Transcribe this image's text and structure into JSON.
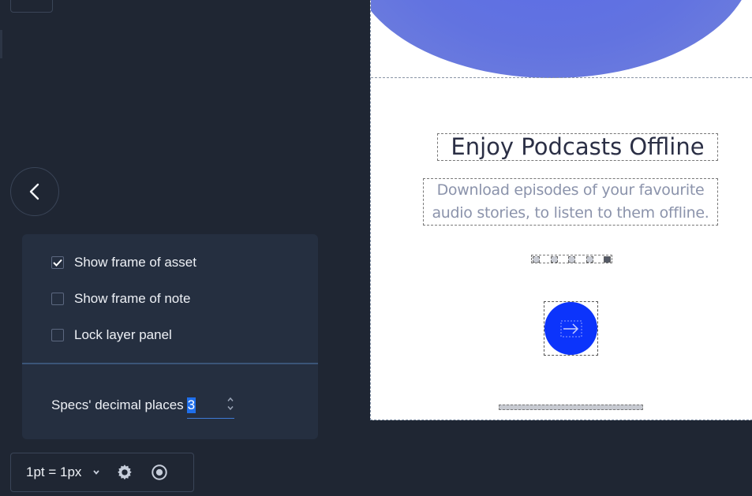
{
  "settings": {
    "show_frame_asset": {
      "label": "Show frame of asset",
      "checked": true
    },
    "show_frame_note": {
      "label": "Show frame of note",
      "checked": false
    },
    "lock_layer_panel": {
      "label": "Lock layer panel",
      "checked": false
    },
    "decimal_label": "Specs' decimal places",
    "decimal_value": "3"
  },
  "toolbar": {
    "unit_label": "1pt = 1px"
  },
  "icons": {
    "back": "chevron-left-icon",
    "unit_dropdown": "chevron-down-icon",
    "settings": "gear-icon",
    "preview": "eye-icon",
    "next": "arrow-right-icon"
  },
  "colors": {
    "background": "#1f2633",
    "panel": "#252f40",
    "accent": "#1f6feb",
    "next_button": "#0c34fb",
    "blob": "#5b6ce8"
  },
  "artboard": {
    "title": "Enjoy Podcasts Offline",
    "subtitle": "Download episodes of your favourite audio stories, to listen to them offline.",
    "page_indicator": {
      "count": 5,
      "active_index": 4
    }
  }
}
